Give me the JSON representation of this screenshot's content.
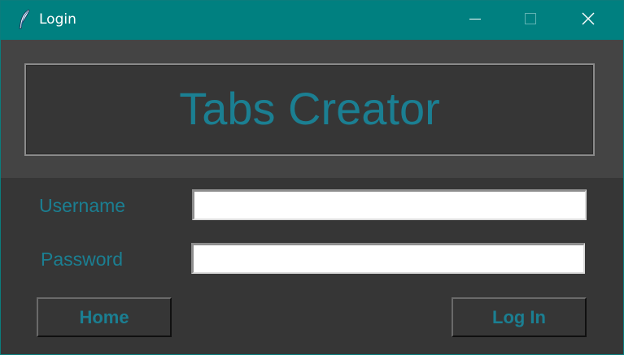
{
  "window": {
    "title": "Login",
    "icon": "feather-icon",
    "controls": {
      "minimize": "minimize-icon",
      "maximize": "maximize-icon",
      "close": "close-icon"
    }
  },
  "header": {
    "title": "Tabs Creator"
  },
  "form": {
    "username_label": "Username",
    "username_value": "",
    "password_label": "Password",
    "password_value": ""
  },
  "buttons": {
    "home_label": "Home",
    "login_label": "Log In"
  },
  "colors": {
    "titlebar": "#008080",
    "background": "#363636",
    "header_frame": "#444444",
    "accent_text": "#1b7f92"
  }
}
